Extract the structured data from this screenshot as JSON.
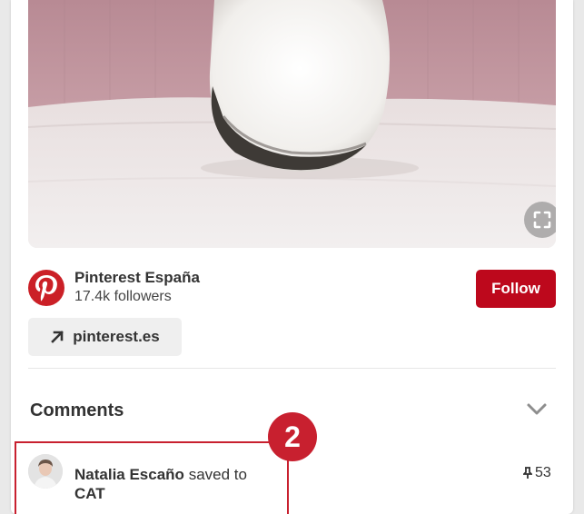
{
  "profile": {
    "name": "Pinterest España",
    "followers": "17.4k followers",
    "follow_label": "Follow"
  },
  "link": {
    "label": "pinterest.es"
  },
  "comments": {
    "title": "Comments"
  },
  "activity": {
    "user": "Natalia Escaño",
    "action": "saved to",
    "board": "CAT",
    "pin_count": "53"
  },
  "annotation": {
    "step": "2"
  },
  "icons": {
    "expand": "expand-icon",
    "logo": "pinterest-logo-icon",
    "arrow": "arrow-up-right-icon",
    "chevron": "chevron-down-icon",
    "pin": "pin-icon"
  },
  "colors": {
    "brand_red": "#bd081c",
    "annotation_red": "#c8202f"
  }
}
